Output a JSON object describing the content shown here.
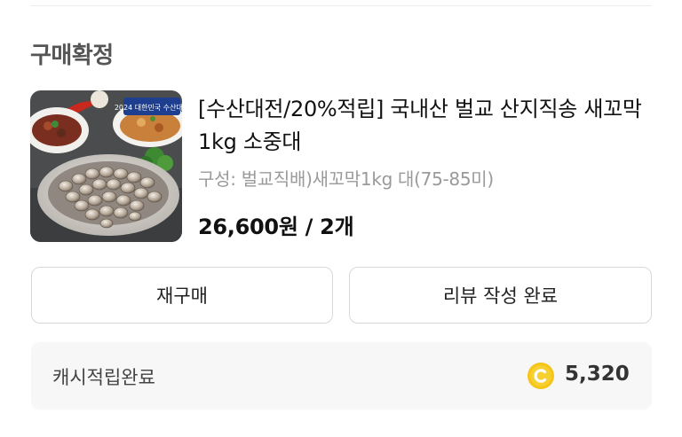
{
  "order": {
    "status_title": "구매확정"
  },
  "product": {
    "thumbnail_badge": "2024 대한민국 수산대전",
    "name": "[수산대전/20%적립] 국내산 벌교 산지직송 새꼬막 1kg 소중대",
    "option": "구성: 벌교직배)새꼬막1kg 대(75-85미)",
    "price": "26,600원 / 2개"
  },
  "actions": {
    "rebuy_label": "재구매",
    "review_label": "리뷰 작성 완료"
  },
  "cashback": {
    "label": "캐시적립완료",
    "amount": "5,320",
    "icon": "coin-icon",
    "coin_color": "#f5c518"
  }
}
